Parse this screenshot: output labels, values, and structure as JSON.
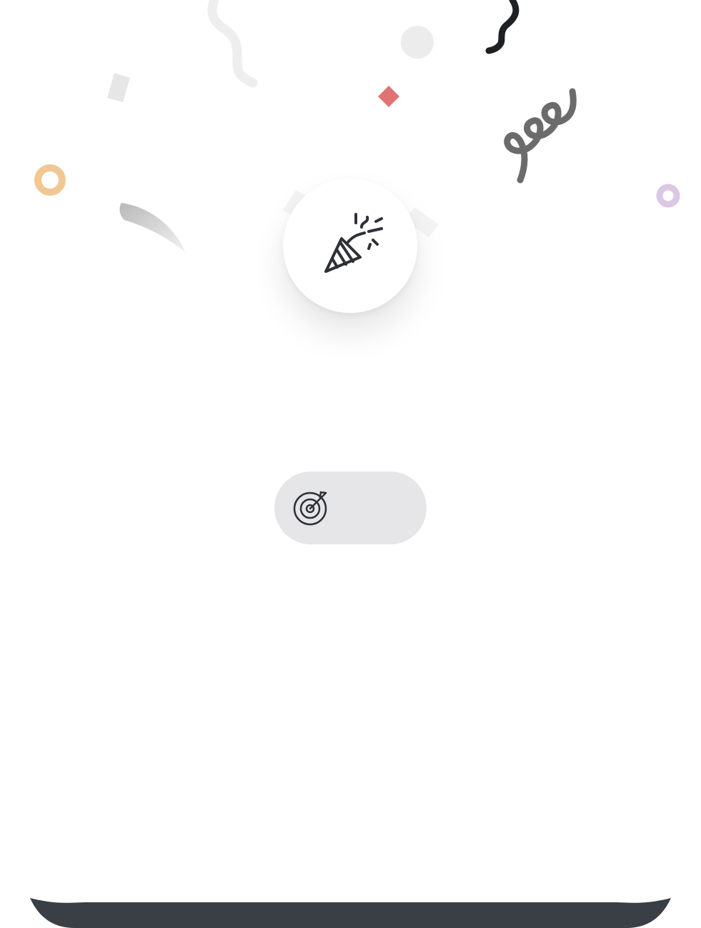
{
  "goal_chip": {
    "icon": "target-icon",
    "label": ""
  },
  "celebration": {
    "icon": "party-popper-icon"
  },
  "colors": {
    "background": "#ffffff",
    "chip_background": "#e6e5e8",
    "icon_stroke": "#2e3238",
    "bottom_bar": "#3a3f45",
    "confetti_red": "#e07474",
    "confetti_orange": "#f1c893",
    "confetti_lilac": "#dcc8e4",
    "confetti_gray": "#e4e4e4",
    "confetti_dark": "#1e2024",
    "confetti_mid": "#6b6b6b"
  }
}
